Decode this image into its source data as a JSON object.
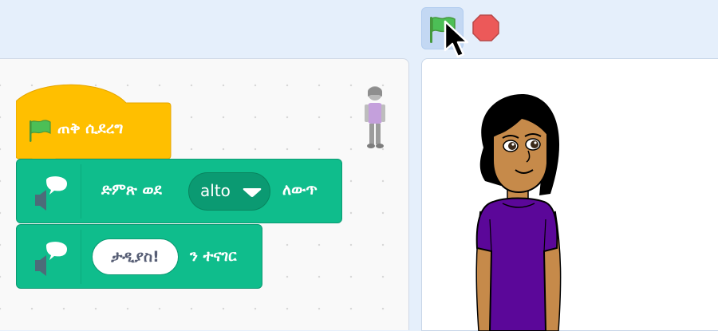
{
  "toolbar": {
    "green_flag_icon": "green-flag-icon",
    "stop_icon": "stop-sign-icon"
  },
  "blocks": {
    "hat": {
      "label": "ጠቅ ሲደረግ",
      "color": "#ffbf00"
    },
    "set_voice": {
      "prefix": "ድምጽ ወደ",
      "dropdown_value": "alto",
      "suffix": "ለውጥ",
      "color": "#0fbd8c"
    },
    "speak": {
      "input_value": "ታዲያስ!",
      "suffix": "ን ተናገር",
      "color": "#0fbd8c"
    }
  },
  "colors": {
    "workspace_bg": "#f9f9f9",
    "stage_bg": "#ffffff",
    "ui_bg": "#e5effb",
    "flag_green": "#4cbf56",
    "stop_red": "#ec5959",
    "sprite_shirt": "#5b0799"
  }
}
